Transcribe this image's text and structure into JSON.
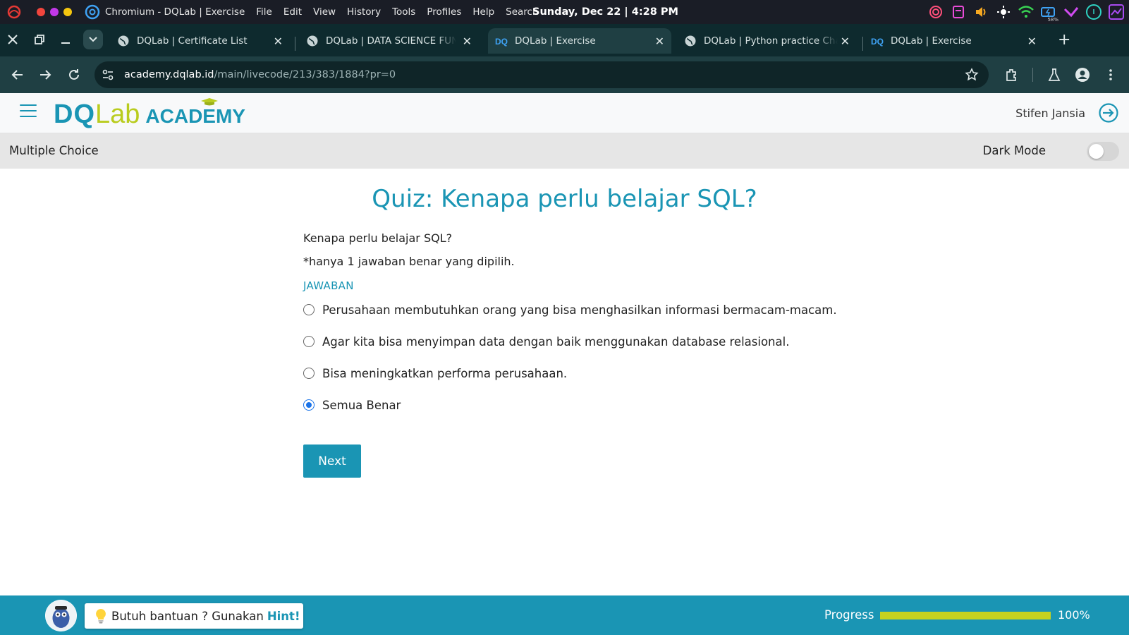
{
  "os": {
    "app_name": "Chromium - DQLab | Exercise",
    "menu": [
      "File",
      "Edit",
      "View",
      "History",
      "Tools",
      "Profiles",
      "Help",
      "Search"
    ],
    "clock": "Sunday, Dec 22 | 4:28 PM",
    "battery": "58%"
  },
  "browser": {
    "tabs": [
      {
        "title": "DQLab | Certificate List",
        "active": false
      },
      {
        "title": "DQLab | DATA SCIENCE FUNDAMENTAL",
        "active": false
      },
      {
        "title": "DQLab | Exercise",
        "active": true
      },
      {
        "title": "DQLab | Python practice Challenge",
        "active": false
      },
      {
        "title": "DQLab | Exercise",
        "active": false
      }
    ],
    "url_host": "academy.dqlab.id",
    "url_path": "/main/livecode/213/383/1884?pr=0"
  },
  "header": {
    "brand_dq": "DQ",
    "brand_lab": "Lab",
    "brand_academy": "ACADEMY",
    "user_name": "Stifen Jansia"
  },
  "section": {
    "title": "Multiple Choice",
    "dark_mode_label": "Dark Mode",
    "dark_mode_on": false
  },
  "quiz": {
    "title": "Quiz: Kenapa perlu belajar SQL?",
    "question": "Kenapa perlu belajar SQL?",
    "instruction": "*hanya 1 jawaban benar yang dipilih.",
    "answers_label": "JAWABAN",
    "options": [
      {
        "label": "Perusahaan membutuhkan orang yang bisa menghasilkan informasi bermacam-macam.",
        "selected": false
      },
      {
        "label": "Agar kita bisa menyimpan data dengan baik menggunakan database relasional.",
        "selected": false
      },
      {
        "label": "Bisa meningkatkan performa perusahaan.",
        "selected": false
      },
      {
        "label": "Semua Benar",
        "selected": true
      }
    ],
    "next_label": "Next"
  },
  "footer": {
    "hint_text": "Butuh bantuan ? Gunakan",
    "hint_link": "Hint!",
    "progress_label": "Progress",
    "progress_value": 1.0,
    "progress_text": "100%"
  },
  "colors": {
    "accent": "#1a95b4",
    "brand_green": "#b9cc1e",
    "progress_fill": "#c6d21f"
  }
}
